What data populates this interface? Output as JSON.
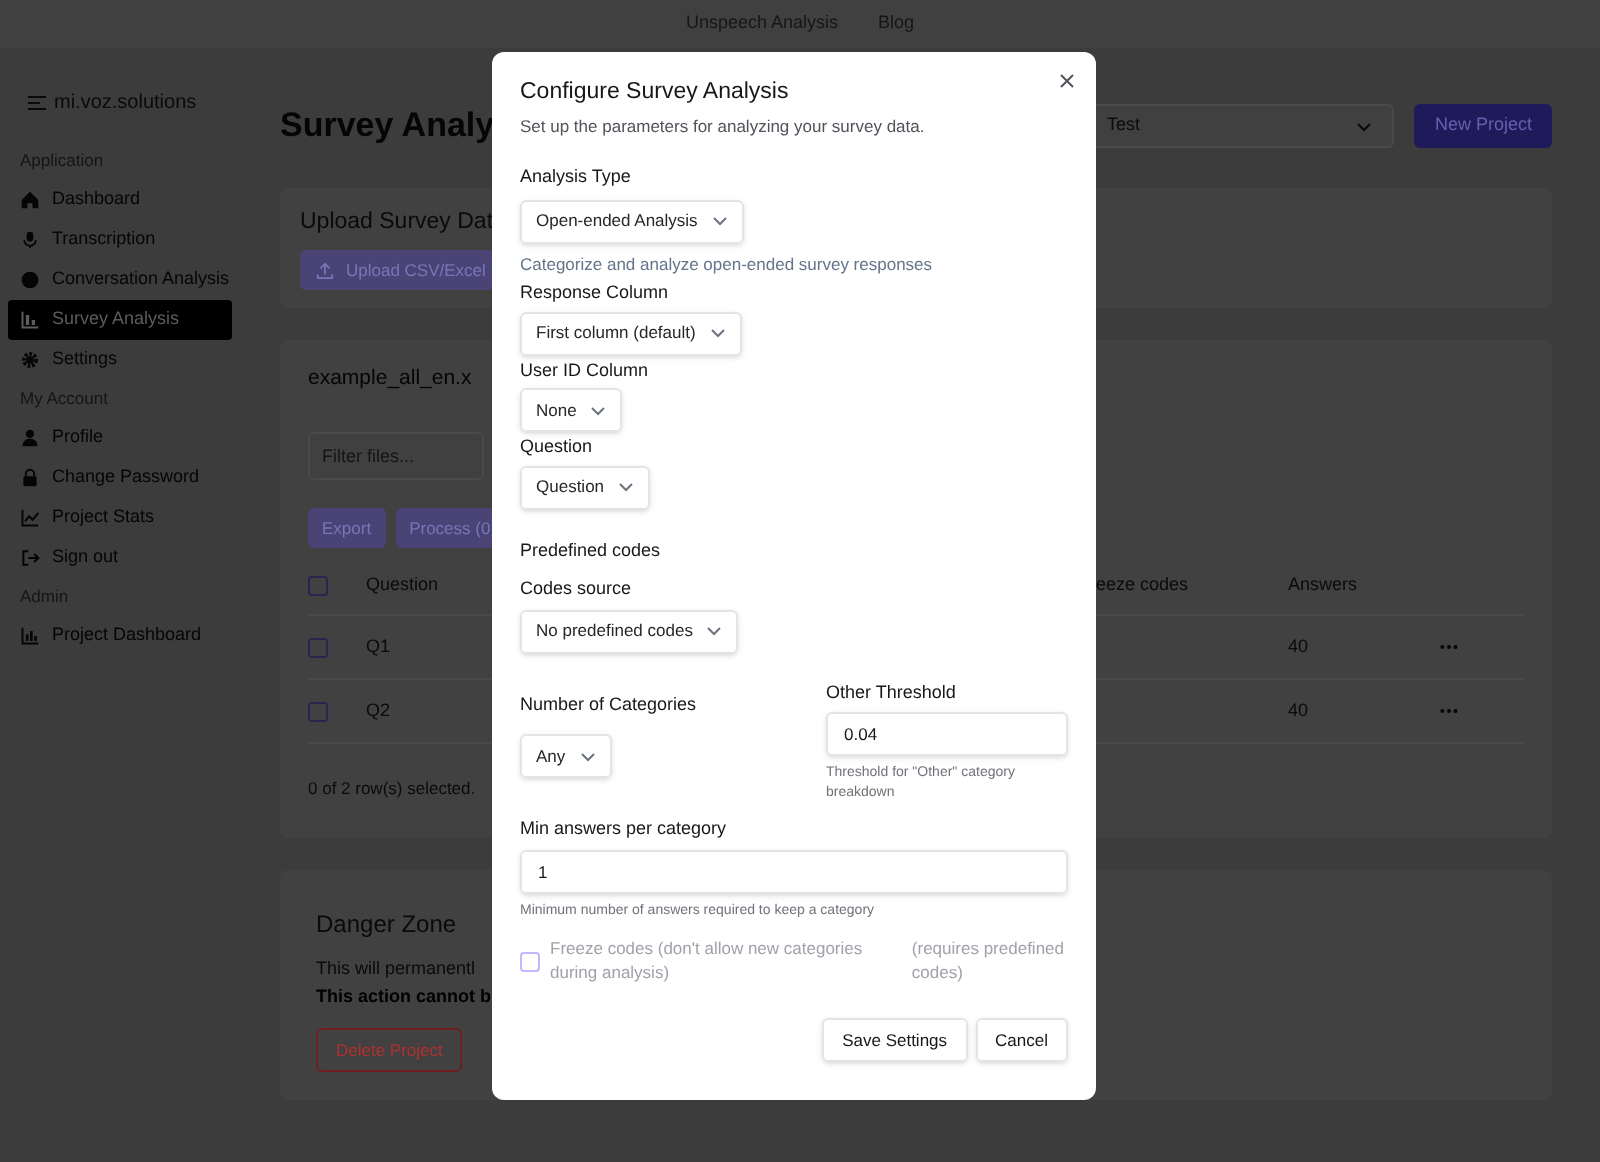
{
  "top_nav": {
    "links": [
      "Unspeech Analysis",
      "Blog"
    ]
  },
  "sidebar": {
    "brand": "mi.voz.solutions",
    "sections": [
      {
        "heading": "Application",
        "items": [
          {
            "label": "Dashboard",
            "selected": false
          },
          {
            "label": "Transcription",
            "selected": false
          },
          {
            "label": "Conversation Analysis",
            "selected": false
          },
          {
            "label": "Survey Analysis",
            "selected": true
          },
          {
            "label": "Settings",
            "selected": false
          }
        ]
      },
      {
        "heading": "My Account",
        "items": [
          {
            "label": "Profile",
            "selected": false
          },
          {
            "label": "Change Password",
            "selected": false
          },
          {
            "label": "Project Stats",
            "selected": false
          },
          {
            "label": "Sign out",
            "selected": false
          }
        ]
      },
      {
        "heading": "Admin",
        "items": [
          {
            "label": "Project Dashboard",
            "selected": false
          }
        ]
      }
    ]
  },
  "header": {
    "title": "Survey Analy",
    "project_select": "Test",
    "new_project_button": "New Project"
  },
  "upload_card": {
    "title": "Upload Survey Dat",
    "upload_button": "Upload CSV/Excel"
  },
  "files_card": {
    "title": "example_all_en.x",
    "filter_placeholder": "Filter files...",
    "buttons": [
      "Export",
      "Process (0"
    ],
    "select_all_checked": false,
    "columns": [
      "Question",
      "eeze codes",
      "Answers"
    ],
    "rows": [
      {
        "question": "Q1",
        "answers": "40",
        "checked": false
      },
      {
        "question": "Q2",
        "answers": "40",
        "checked": false
      }
    ],
    "selection_summary": "0 of 2 row(s) selected."
  },
  "danger_zone": {
    "title": "Danger Zone",
    "text": "This will permanentl",
    "warning": "This action cannot b",
    "delete_button": "Delete Project"
  },
  "dialog": {
    "title": "Configure Survey Analysis",
    "subtitle": "Set up the parameters for analyzing your survey data.",
    "analysis_type": {
      "label": "Analysis Type",
      "value": "Open-ended Analysis",
      "description": "Categorize and analyze open-ended survey responses"
    },
    "response_column": {
      "label": "Response Column",
      "value": "First column (default)"
    },
    "user_id_column": {
      "label": "User ID Column",
      "value": "None"
    },
    "question": {
      "label": "Question",
      "value": "Question"
    },
    "predefined_codes": {
      "heading": "Predefined codes",
      "label": "Codes source",
      "value": "No predefined codes"
    },
    "number_of_categories": {
      "label": "Number of Categories",
      "value": "Any"
    },
    "other_threshold": {
      "label": "Other Threshold",
      "value": "0.04",
      "hint": "Threshold for \"Other\" category breakdown"
    },
    "min_answers": {
      "label": "Min answers per category",
      "value": "1",
      "hint": "Minimum number of answers required to keep a category"
    },
    "freeze_codes": {
      "label": "Freeze codes (don't allow new categories during analysis)",
      "note": "(requires predefined codes)",
      "checked": false,
      "disabled": true
    },
    "buttons": [
      "Save Settings",
      "Cancel"
    ]
  }
}
